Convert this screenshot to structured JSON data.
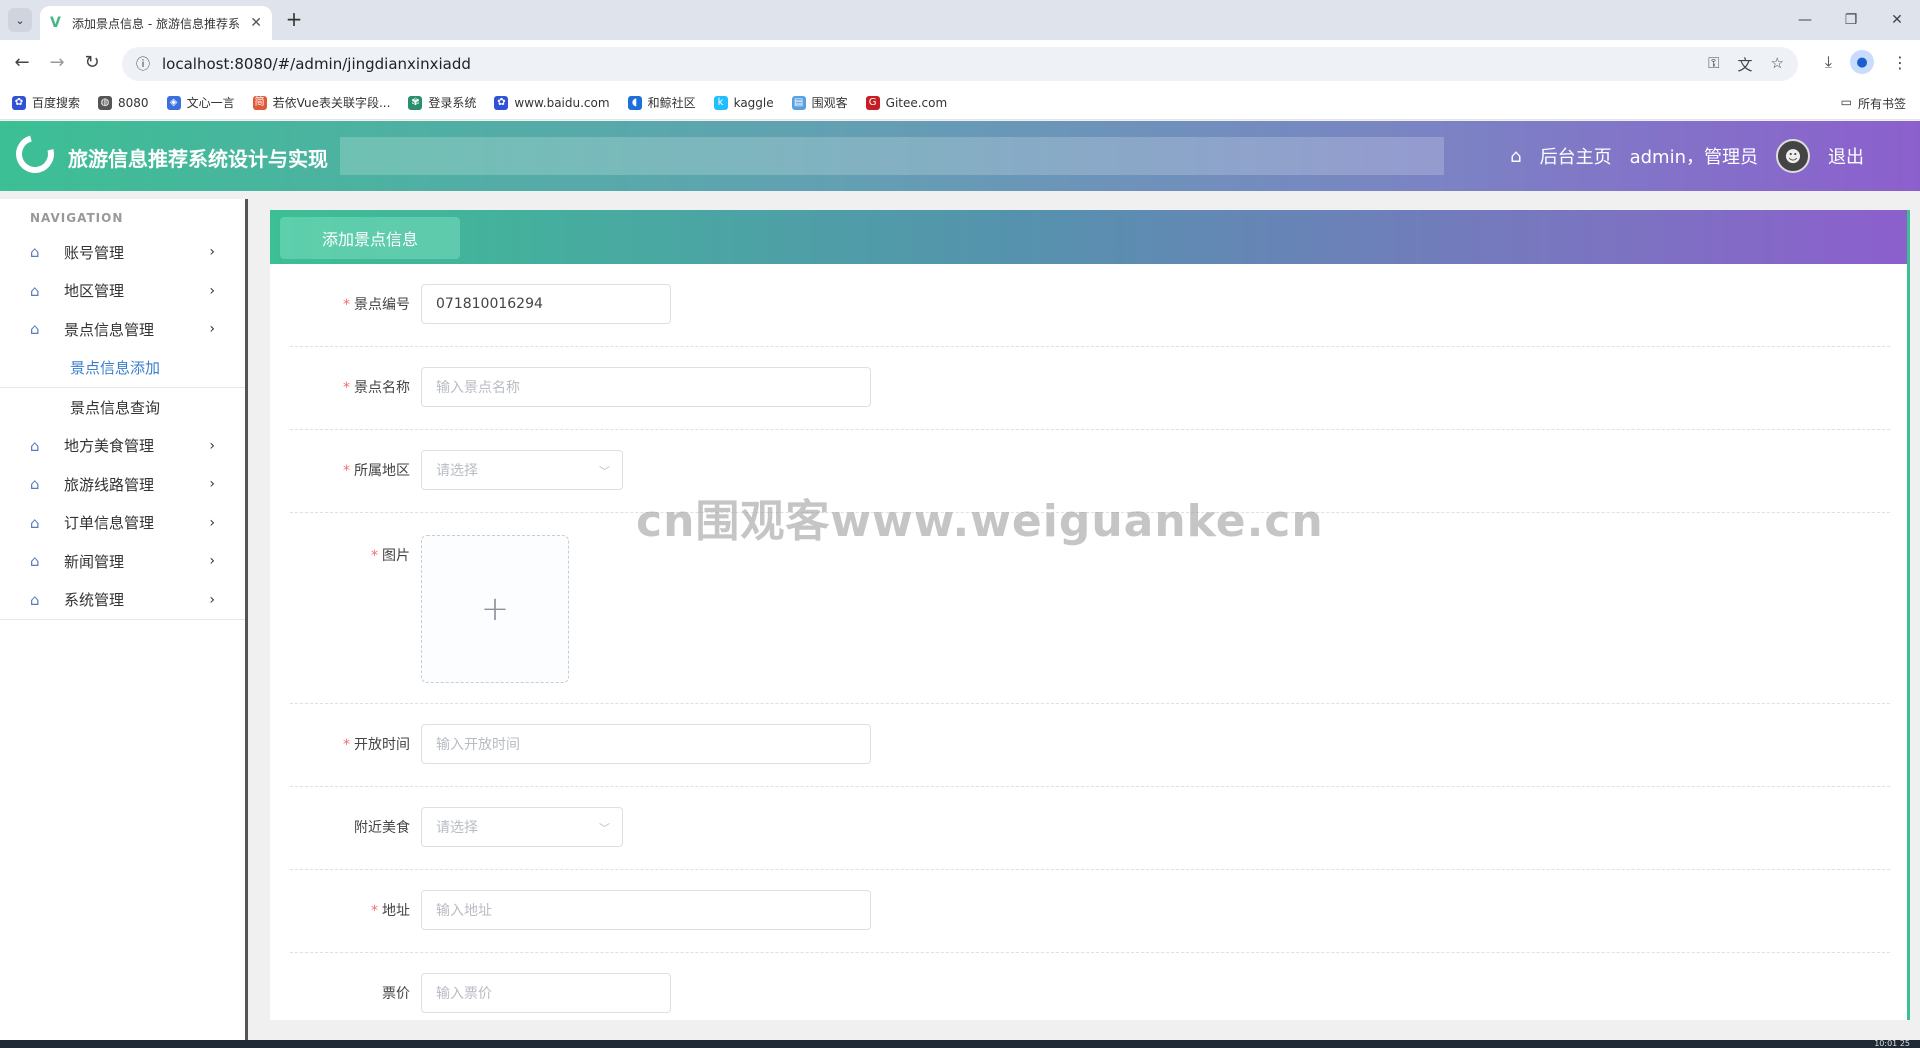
{
  "browser": {
    "tab_title": "添加景点信息 - 旅游信息推荐系",
    "url": "localhost:8080/#/admin/jingdianxinxiadd",
    "bookmarks": [
      {
        "label": "百度搜索",
        "icon": "baidu-icon",
        "color": "#3052d6"
      },
      {
        "label": "8080",
        "icon": "globe-icon",
        "color": "#555555"
      },
      {
        "label": "文心一言",
        "icon": "wenxin-icon",
        "color": "#3a6fe0"
      },
      {
        "label": "若依Vue表关联字段...",
        "icon": "ruoyi-icon",
        "color": "#e05a3a"
      },
      {
        "label": "登录系统",
        "icon": "leaf-icon",
        "color": "#2a8f6a"
      },
      {
        "label": "www.baidu.com",
        "icon": "baidu-icon",
        "color": "#3052d6"
      },
      {
        "label": "和鲸社区",
        "icon": "heywhale-icon",
        "color": "#1e6fd9"
      },
      {
        "label": "kaggle",
        "icon": "kaggle-icon",
        "color": "#20beff"
      },
      {
        "label": "围观客",
        "icon": "weiguanke-icon",
        "color": "#5aa0e0"
      },
      {
        "label": "Gitee.com",
        "icon": "gitee-icon",
        "color": "#c71d23"
      }
    ],
    "bookmarks_folder": "所有书签"
  },
  "header": {
    "title": "旅游信息推荐系统设计与实现",
    "home_label": "后台主页",
    "user_label": "admin，管理员",
    "logout_label": "退出"
  },
  "sidebar": {
    "heading": "NAVIGATION",
    "items": [
      {
        "label": "账号管理"
      },
      {
        "label": "地区管理"
      },
      {
        "label": "景点信息管理"
      }
    ],
    "subitems": [
      {
        "label": "景点信息添加",
        "active": true
      },
      {
        "label": "景点信息查询",
        "active": false
      }
    ],
    "items_after": [
      {
        "label": "地方美食管理"
      },
      {
        "label": "旅游线路管理"
      },
      {
        "label": "订单信息管理"
      },
      {
        "label": "新闻管理"
      },
      {
        "label": "系统管理"
      }
    ]
  },
  "page": {
    "tab_label": "添加景点信息"
  },
  "form": {
    "code": {
      "label": "景点编号",
      "value": "071810016294",
      "required": true
    },
    "name": {
      "label": "景点名称",
      "placeholder": "输入景点名称",
      "required": true
    },
    "region": {
      "label": "所属地区",
      "placeholder": "请选择",
      "required": true
    },
    "image": {
      "label": "图片",
      "required": true
    },
    "open_time": {
      "label": "开放时间",
      "placeholder": "输入开放时间",
      "required": true
    },
    "nearby_food": {
      "label": "附近美食",
      "placeholder": "请选择",
      "required": false
    },
    "address": {
      "label": "地址",
      "placeholder": "输入地址",
      "required": true
    },
    "price": {
      "label": "票价",
      "placeholder": "输入票价",
      "required": false
    }
  },
  "watermark": "cn围观客www.weiguanke.cn",
  "taskbar_time": "10:01 25"
}
